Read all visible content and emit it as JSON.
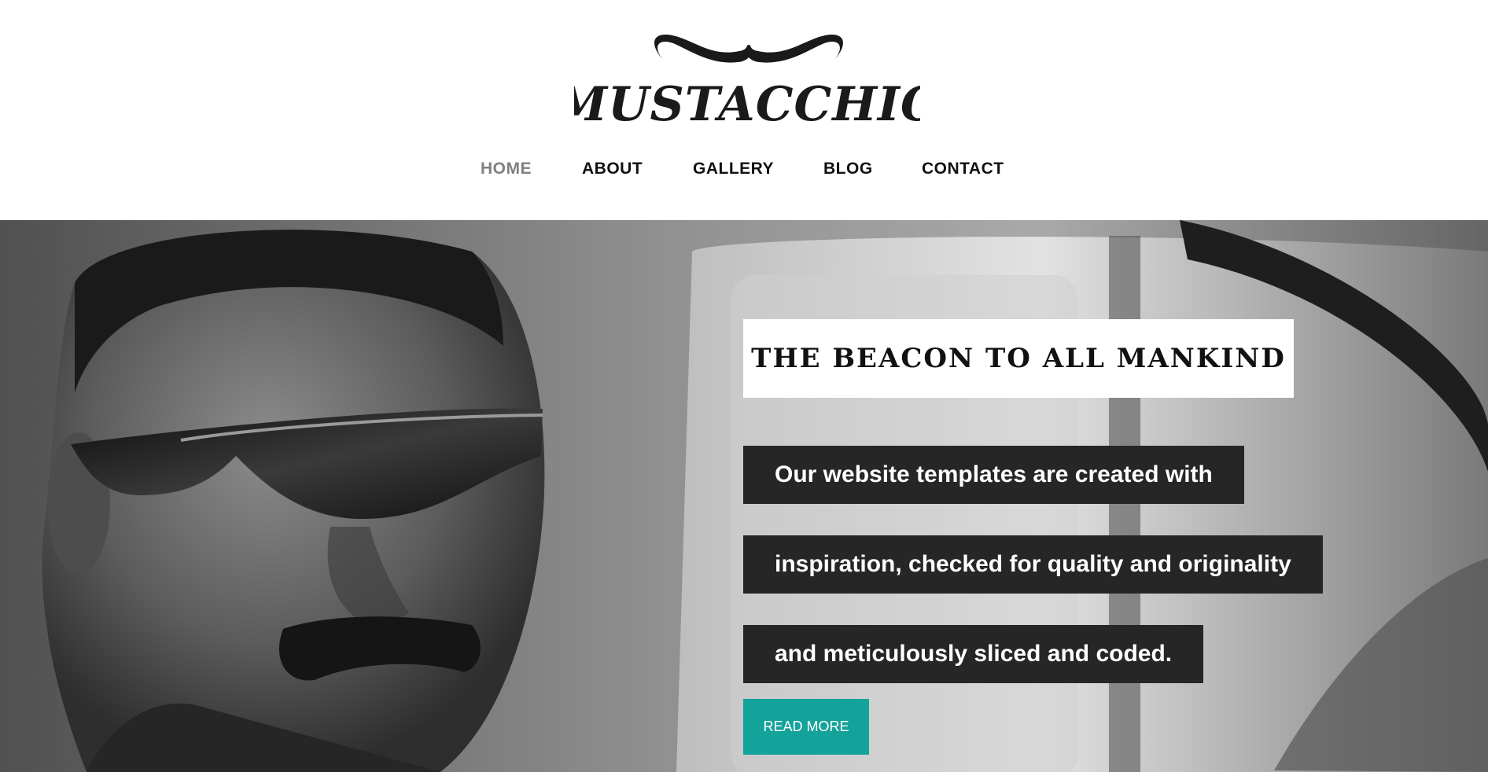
{
  "brand": {
    "logo_text": "MUSTACCHIO",
    "colors": {
      "text": "#111111",
      "logo": "#1a1a1a"
    }
  },
  "nav": {
    "items": [
      {
        "label": "HOME",
        "active": true
      },
      {
        "label": "ABOUT",
        "active": false
      },
      {
        "label": "GALLERY",
        "active": false
      },
      {
        "label": "BLOG",
        "active": false
      },
      {
        "label": "CONTACT",
        "active": false
      }
    ],
    "colors": {
      "active": "#808080",
      "default": "#111111"
    }
  },
  "hero": {
    "headline": "THE BEACON TO ALL MANKIND",
    "lines": [
      "Our website templates are created with",
      "inspiration, checked for quality and originality",
      "and meticulously sliced and coded."
    ],
    "read_more_label": "READ MORE",
    "colors": {
      "strip": "#262626",
      "button": "#14a39a",
      "headline_bg": "#ffffff"
    }
  }
}
